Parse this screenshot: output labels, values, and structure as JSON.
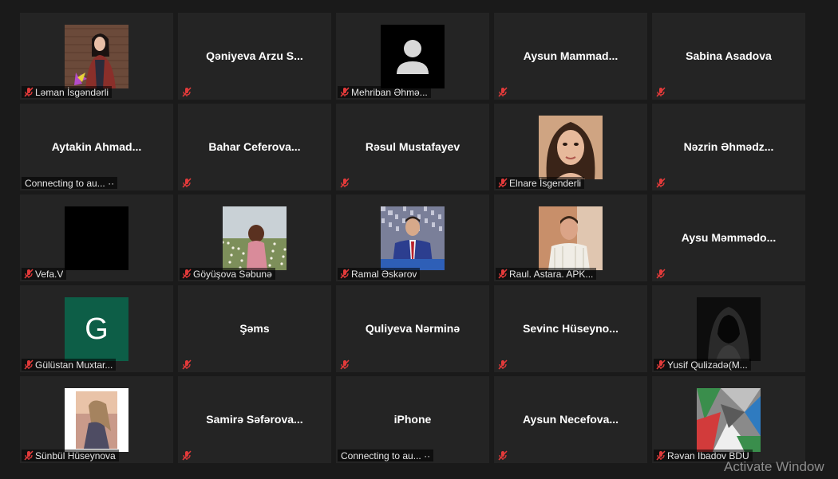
{
  "participants": [
    {
      "display": "Ləman İsgəndərli",
      "bottom": "Ləman İsgəndərli",
      "type": "photo",
      "photo": "woman-brick-wall"
    },
    {
      "display": "Qəniyeva  Arzu  S...",
      "type": "name"
    },
    {
      "display": "Mehriban Əhmə...",
      "bottom": "Mehriban Əhmə...",
      "type": "default-avatar"
    },
    {
      "display": "Aysun  Mammad...",
      "type": "name"
    },
    {
      "display": "Sabina Asadova",
      "type": "name"
    },
    {
      "display": "Aytakin  Ahmad...",
      "type": "name",
      "status": "Connecting to au... ··"
    },
    {
      "display": "Bahar  Ceferova...",
      "type": "name"
    },
    {
      "display": "Rəsul Mustafayev",
      "type": "name"
    },
    {
      "display": "Elnare İsgenderli",
      "bottom": "Elnare İsgenderli",
      "type": "photo",
      "photo": "woman-portrait"
    },
    {
      "display": "Nəzrin  Əhmədz...",
      "type": "name"
    },
    {
      "display": "Vefa.V",
      "bottom": "Vefa.V",
      "type": "black"
    },
    {
      "display": "Göyüşova Səbunə",
      "bottom": "Göyüşova Səbunə",
      "type": "photo",
      "photo": "woman-field"
    },
    {
      "display": "Ramal Əskərov",
      "bottom": "Ramal Əskərov",
      "type": "photo",
      "photo": "man-suit"
    },
    {
      "display": "Raul. Astara. APK...",
      "bottom": "Raul. Astara. APK...",
      "type": "photo",
      "photo": "man-shirt"
    },
    {
      "display": "Aysu  Məmmədo...",
      "type": "name"
    },
    {
      "display": "Gülüstan Muxtar...",
      "bottom": "Gülüstan Muxtar...",
      "type": "letter",
      "letter": "G"
    },
    {
      "display": "Şəms",
      "type": "name"
    },
    {
      "display": "Quliyeva Nərminə",
      "type": "name"
    },
    {
      "display": "Sevinc  Hüseyno...",
      "type": "name"
    },
    {
      "display": "Yusif Qulizadə(M...",
      "bottom": "Yusif Qulizadə(M...",
      "type": "photo",
      "photo": "hooded-figure"
    },
    {
      "display": "Sünbül Hüseynova",
      "bottom": "Sünbül Hüseynova",
      "type": "photo",
      "photo": "woman-sunset"
    },
    {
      "display": "Samirə  Səfərova...",
      "type": "name"
    },
    {
      "display": "iPhone",
      "type": "name",
      "status": "Connecting to au... ··"
    },
    {
      "display": "Aysun  Necefova...",
      "type": "name"
    },
    {
      "display": "Rəvan Ibadov BDU",
      "bottom": "Rəvan Ibadov BDU",
      "type": "photo",
      "photo": "flag-collage"
    }
  ],
  "watermark": "Activate Window",
  "colors": {
    "mute": "#e23a3a",
    "tile": "#242424",
    "background": "#1a1a1a",
    "letter_avatar": "#0d5e47"
  },
  "icons": {
    "mute": "muted-mic-icon",
    "default": "person-icon"
  }
}
